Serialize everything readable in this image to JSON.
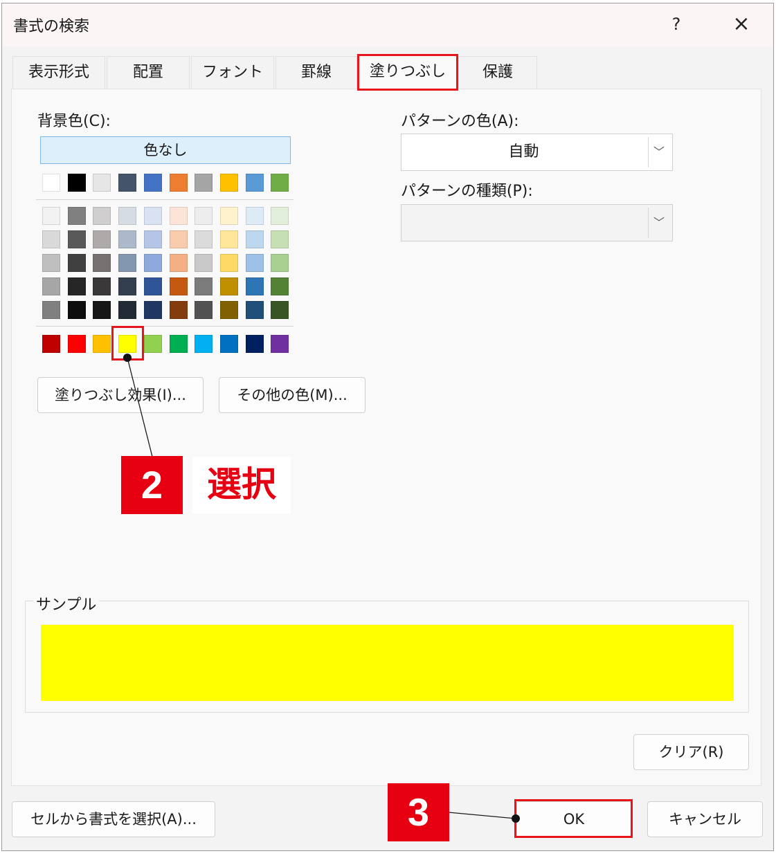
{
  "dialog": {
    "title": "書式の検索",
    "help_label": "?",
    "close_label": "×"
  },
  "tabs": [
    {
      "label": "表示形式",
      "active": false
    },
    {
      "label": "配置",
      "active": false
    },
    {
      "label": "フォント",
      "active": false
    },
    {
      "label": "罫線",
      "active": false
    },
    {
      "label": "塗りつぶし",
      "active": true
    },
    {
      "label": "保護",
      "active": false
    }
  ],
  "background": {
    "label": "背景色(C):",
    "no_color_label": "色なし",
    "theme_row": [
      "#ffffff",
      "#000000",
      "#e7e6e6",
      "#44546a",
      "#4472c4",
      "#ed7d31",
      "#a5a5a5",
      "#ffc000",
      "#5b9bd5",
      "#70ad47"
    ],
    "tint_rows": [
      [
        "#f2f2f2",
        "#808080",
        "#d0cece",
        "#d6dce4",
        "#d9e1f2",
        "#fce4d6",
        "#ededed",
        "#fff2cc",
        "#ddebf7",
        "#e2efda"
      ],
      [
        "#d9d9d9",
        "#595959",
        "#aeaaaa",
        "#acb9ca",
        "#b4c6e7",
        "#f8cbad",
        "#dbdbdb",
        "#ffe699",
        "#bdd7ee",
        "#c6e0b4"
      ],
      [
        "#bfbfbf",
        "#404040",
        "#757171",
        "#8497b0",
        "#8ea9db",
        "#f4b084",
        "#c9c9c9",
        "#ffd966",
        "#9bc2e6",
        "#a9d08e"
      ],
      [
        "#a6a6a6",
        "#262626",
        "#3a3838",
        "#333f4f",
        "#2f5597",
        "#c65911",
        "#7b7b7b",
        "#bf8f00",
        "#2e75b6",
        "#548235"
      ],
      [
        "#808080",
        "#0d0d0d",
        "#161616",
        "#222b35",
        "#203764",
        "#833c0c",
        "#525252",
        "#806000",
        "#1f4e78",
        "#375623"
      ]
    ],
    "standard_row": [
      "#c00000",
      "#ff0000",
      "#ffc000",
      "#ffff00",
      "#92d050",
      "#00b050",
      "#00b0f0",
      "#0070c0",
      "#002060",
      "#7030a0"
    ],
    "selected_color": "#ffff00",
    "fill_effects_label": "塗りつぶし効果(I)...",
    "more_colors_label": "その他の色(M)..."
  },
  "pattern": {
    "color_label": "パターンの色(A):",
    "color_value": "自動",
    "style_label": "パターンの種類(P):",
    "style_value": ""
  },
  "sample": {
    "label": "サンプル"
  },
  "buttons": {
    "clear_label": "クリア(R)",
    "choose_from_cell_label": "セルから書式を選択(A)...",
    "ok_label": "OK",
    "cancel_label": "キャンセル"
  },
  "callouts": {
    "step2": {
      "number": "2",
      "text": "選択"
    },
    "step3": {
      "number": "3"
    }
  },
  "colors": {
    "highlight": "#e8141b",
    "callout_red": "#e60012",
    "sample_fill": "#ffff00"
  }
}
